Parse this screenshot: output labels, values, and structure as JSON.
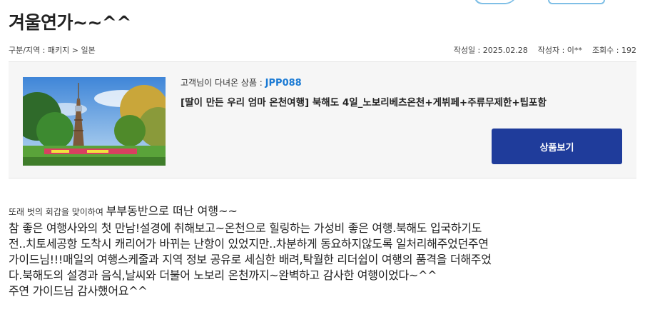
{
  "post": {
    "title": "겨울연가~~^^",
    "category": "구분/지역 : 패키지 > 일본",
    "date": "작성일 : 2025.02.28",
    "author": "작성자 : 이**",
    "views": "조회수 : 192"
  },
  "product": {
    "code_label": "고객님이 다녀온 상품 : ",
    "code": "JPP088",
    "title": "[딸이 만든 우리 엄마 온천여행] 북해도 4일_노보리베츠온천+게뷔페+주류무제한+팁포함",
    "button_label": "상품보기",
    "image_icon": "tower-park-photo"
  },
  "review": {
    "intro_small": "또래 벗의 회갑을 맞이하여 ",
    "intro_big": "부부동반으로 떠난 여행~~",
    "body": "참 좋은 여행사와의 첫 만남!설경에 취해보고~온천으로 힐링하는 가성비 좋은 여행.북해도 입국하기도\n전..치토세공항 도착시 캐리어가 바뀌는 난항이 있었지만..차분하게 동요하지않도록 일처리해주었던주연\n가이드님!!!매일의 여행스케줄과 지역 정보 공유로 세심한 배려,탁월한 리더쉽이 여행의 품격을 더해주었\n다.북해도의 설경과 음식,날씨와 더불어 노보리 온천까지~완벽하고 감사한 여행이었다~^^\n주연 가이드님 감사했어요^^"
  },
  "colors": {
    "button_bg": "#1f3c9b",
    "code_color": "#1a7ad4",
    "box_bg": "#f6f6f6"
  }
}
